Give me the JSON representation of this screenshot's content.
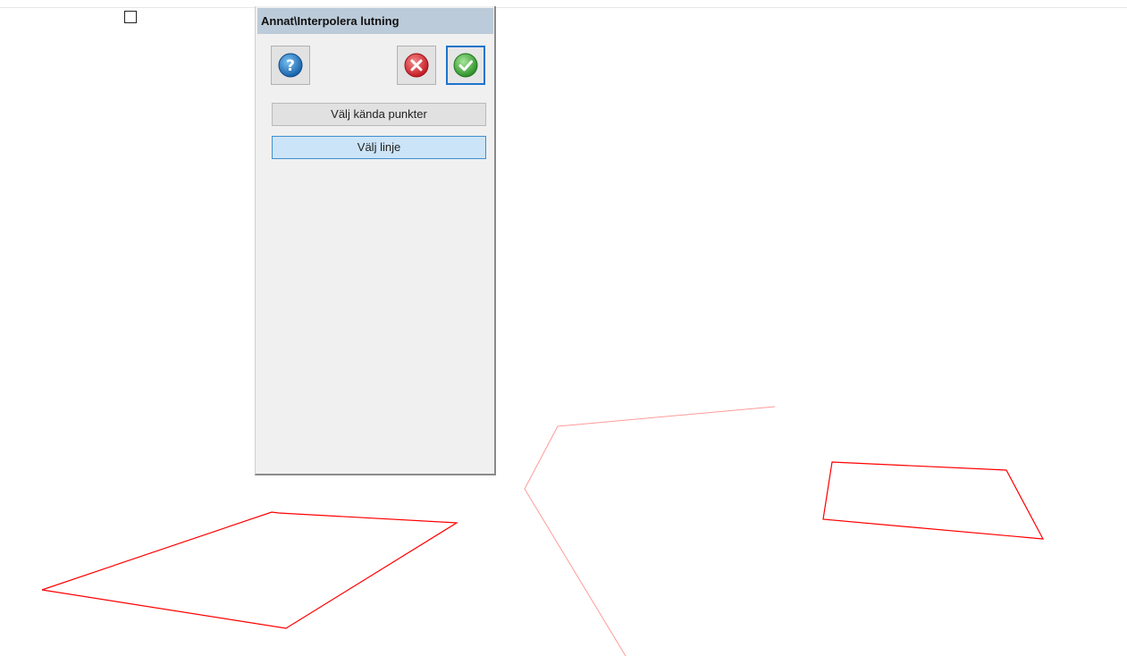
{
  "panel": {
    "title": "Annat\\Interpolera lutning",
    "buttons": {
      "help": {
        "icon": "help-icon",
        "color": "#1a78c2"
      },
      "cancel": {
        "icon": "cancel-icon",
        "color": "#d8313a"
      },
      "ok": {
        "icon": "check-icon",
        "color": "#3aa832"
      },
      "select_known_points": "Välj kända punkter",
      "select_line": "Välj linje"
    }
  },
  "canvas": {
    "line_color": "#ff0000",
    "faint_line_color": "#ff9a9a"
  }
}
